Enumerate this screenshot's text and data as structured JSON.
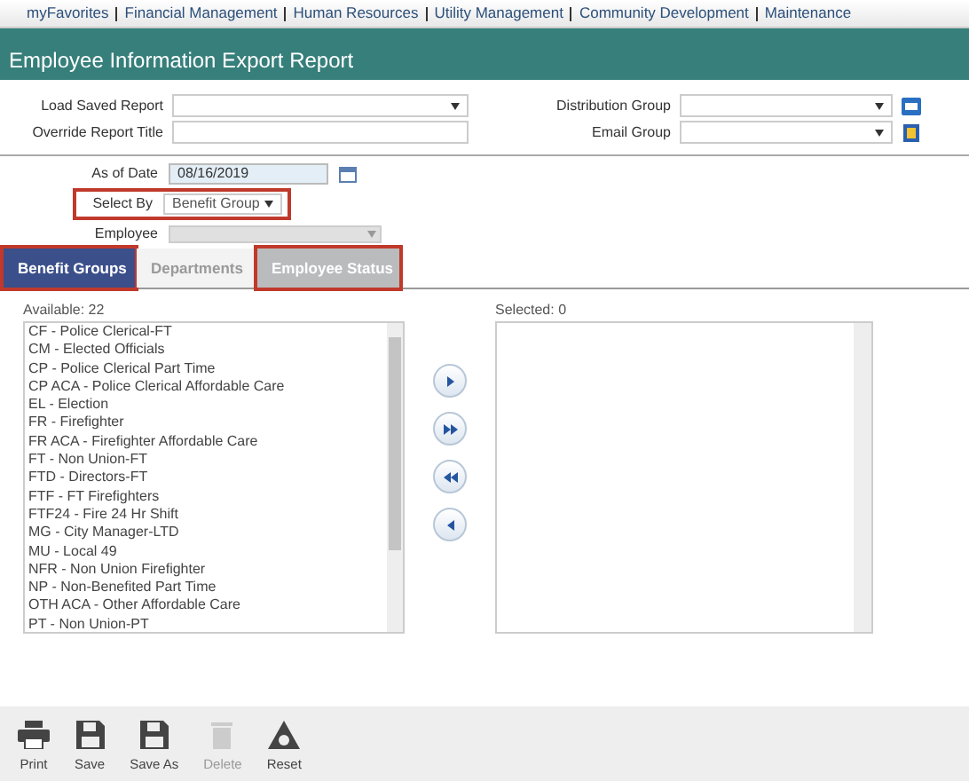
{
  "nav": [
    "myFavorites",
    "Financial Management",
    "Human Resources",
    "Utility Management",
    "Community Development",
    "Maintenance"
  ],
  "title": "Employee Information Export Report",
  "form_left": [
    {
      "label": "Load Saved Report",
      "kind": "dropdown"
    },
    {
      "label": "Override Report Title",
      "kind": "text"
    }
  ],
  "form_right": [
    {
      "label": "Distribution Group",
      "kind": "dropdown"
    },
    {
      "label": "Email Group",
      "kind": "dropdown"
    }
  ],
  "as_of_date": {
    "label": "As of Date",
    "value": "08/16/2019"
  },
  "select_by": {
    "label": "Select By",
    "value": "Benefit Group",
    "highlighted": true
  },
  "employee": {
    "label": "Employee",
    "disabled": true
  },
  "tabs": [
    {
      "label": "Benefit Groups",
      "selected": true,
      "disabled": false,
      "highlighted": true
    },
    {
      "label": "Departments",
      "selected": false,
      "disabled": true,
      "highlighted": false
    },
    {
      "label": "Employee Status",
      "selected": false,
      "disabled": false,
      "highlighted": true
    }
  ],
  "available": {
    "label": "Available: 22",
    "items": [
      "CF - Police Clerical-FT",
      "CM - Elected Officials",
      "CP - Police Clerical Part Time",
      "CP ACA - Police Clerical Affordable Care",
      "EL - Election",
      "FR - Firefighter",
      "FR ACA - Firefighter Affordable Care",
      "FT - Non Union-FT",
      "FTD - Directors-FT",
      "FTF - FT Firefighters",
      "FTF24 - Fire 24 Hr Shift",
      "MG - City Manager-LTD",
      "MU - Local 49",
      "NFR - Non Union Firefighter",
      "NP - Non-Benefited Part Time",
      "OTH ACA - Other Affordable Care",
      "PT - Non Union-PT"
    ]
  },
  "selected": {
    "label": "Selected: 0"
  },
  "toolbar": [
    {
      "label": "Print",
      "kind": "print",
      "disabled": false
    },
    {
      "label": "Save",
      "kind": "save",
      "disabled": false
    },
    {
      "label": "Save As",
      "kind": "save",
      "disabled": false
    },
    {
      "label": "Delete",
      "kind": "delete",
      "disabled": true
    },
    {
      "label": "Reset",
      "kind": "reset",
      "disabled": false
    }
  ]
}
